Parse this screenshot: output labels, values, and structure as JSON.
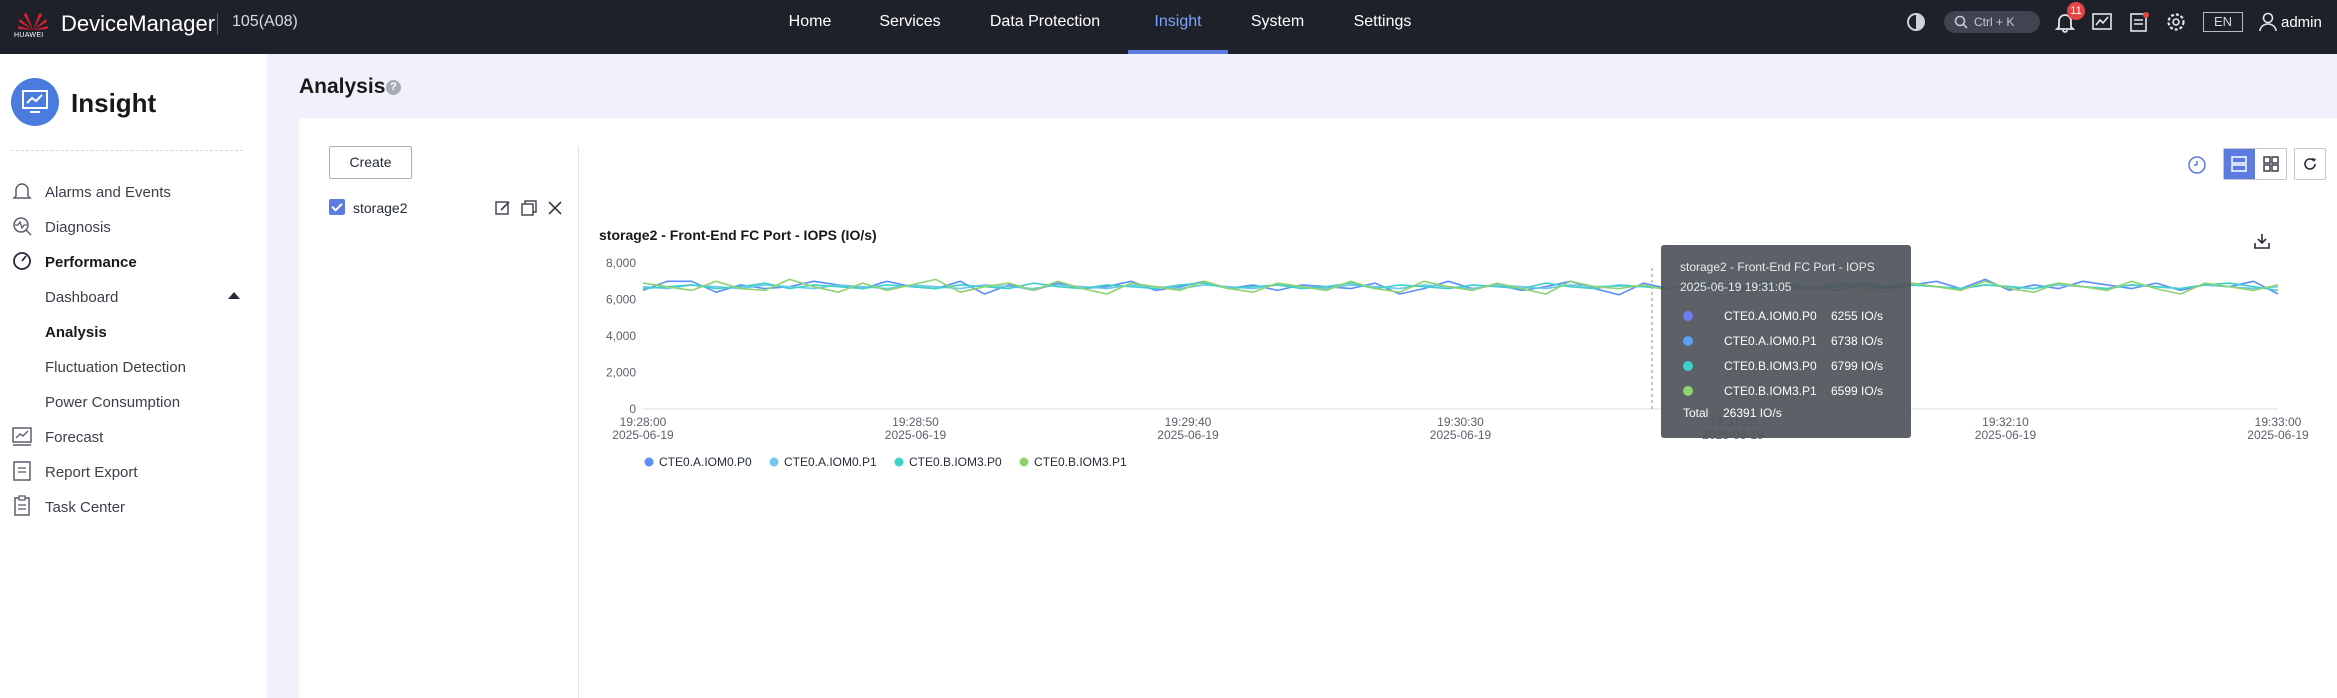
{
  "app": {
    "brand_small": "HUAWEI",
    "brand": "DeviceManager",
    "device_id": "105(A08)"
  },
  "nav": {
    "items": [
      "Home",
      "Services",
      "Data Protection",
      "Insight",
      "System",
      "Settings"
    ],
    "active": "Insight"
  },
  "topbar": {
    "search_hint": "Ctrl + K",
    "notification_count": "11",
    "language": "EN",
    "user": "admin"
  },
  "sidebar": {
    "title": "Insight",
    "items": [
      {
        "label": "Alarms and Events",
        "icon": "bell-icon"
      },
      {
        "label": "Diagnosis",
        "icon": "diagnosis-icon"
      },
      {
        "label": "Performance",
        "icon": "gauge-icon",
        "expanded": true
      },
      {
        "label": "Dashboard",
        "sub": true
      },
      {
        "label": "Analysis",
        "sub": true,
        "active": true
      },
      {
        "label": "Fluctuation Detection",
        "sub": true
      },
      {
        "label": "Power Consumption",
        "sub": true
      },
      {
        "label": "Forecast",
        "icon": "forecast-icon"
      },
      {
        "label": "Report Export",
        "icon": "report-icon"
      },
      {
        "label": "Task Center",
        "icon": "clipboard-icon"
      }
    ]
  },
  "main": {
    "page_title": "Analysis",
    "create_label": "Create",
    "object": {
      "name": "storage2",
      "checked": true
    }
  },
  "colors": {
    "accent": "#5e7ce0",
    "series": [
      "#5b8ff9",
      "#6dc8ec",
      "#3fd1c9",
      "#8fd36f"
    ]
  },
  "chart_data": {
    "type": "line",
    "title": "storage2 - Front-End FC Port - IOPS (IO/s)",
    "ylim": [
      0,
      8000
    ],
    "yticks": [
      "8,000",
      "6,000",
      "4,000",
      "2,000",
      "0"
    ],
    "xticks": [
      {
        "time": "19:28:00",
        "date": "2025-06-19"
      },
      {
        "time": "19:28:50",
        "date": "2025-06-19"
      },
      {
        "time": "19:29:40",
        "date": "2025-06-19"
      },
      {
        "time": "19:30:30",
        "date": "2025-06-19"
      },
      {
        "time": "19:31:20",
        "date": "2025-06-19"
      },
      {
        "time": "19:32:10",
        "date": "2025-06-19"
      },
      {
        "time": "19:33:00",
        "date": "2025-06-19"
      }
    ],
    "series": [
      {
        "name": "CTE0.A.IOM0.P0",
        "values": [
          6500,
          7000,
          7000,
          6400,
          6800,
          6600,
          6700,
          7000,
          6800,
          6600,
          7000,
          6700,
          6600,
          7000,
          6300,
          6800,
          6500,
          6900,
          6600,
          6700,
          7000,
          6500,
          6700,
          7000,
          6600,
          6800,
          6500,
          6800,
          6700,
          6600,
          6900,
          6300,
          6600,
          7000,
          6600,
          6800,
          6500,
          6700,
          7000,
          6600,
          6255,
          6900,
          6600,
          6800,
          6500,
          6700,
          7000,
          6600,
          6700,
          6500,
          6800,
          6700,
          6800,
          7000,
          6600,
          7100,
          6500,
          6800,
          6600,
          7000,
          6800,
          6600,
          6900,
          6500,
          6800,
          6700,
          7000,
          6300
        ]
      },
      {
        "name": "CTE0.A.IOM0.P1",
        "values": [
          6700,
          6600,
          6800,
          6700,
          6600,
          6800,
          6700,
          6600,
          6800,
          6700,
          6600,
          6800,
          6700,
          6600,
          6800,
          6700,
          6600,
          6800,
          6700,
          6600,
          6800,
          6700,
          6600,
          6800,
          6700,
          6600,
          6800,
          6700,
          6600,
          6800,
          6700,
          6600,
          6800,
          6700,
          6600,
          6800,
          6700,
          6600,
          6800,
          6700,
          6738,
          6700,
          6600,
          6800,
          6700,
          6600,
          6800,
          6700,
          6600,
          6800,
          6700,
          6600,
          6800,
          6700,
          6600,
          6800,
          6700,
          6600,
          6800,
          6700,
          6600,
          6800,
          6700,
          6600,
          6800,
          6700,
          6600,
          6700
        ]
      },
      {
        "name": "CTE0.B.IOM3.P0",
        "values": [
          6600,
          6700,
          6800,
          6600,
          6700,
          6900,
          6600,
          6800,
          6700,
          6600,
          6800,
          6700,
          6600,
          6800,
          6700,
          6600,
          6900,
          6700,
          6600,
          6800,
          6700,
          6600,
          6800,
          6900,
          6600,
          6700,
          6800,
          6600,
          6700,
          6900,
          6600,
          6800,
          6700,
          6600,
          6800,
          6700,
          6600,
          6900,
          6700,
          6600,
          6799,
          6700,
          6600,
          6800,
          6900,
          6600,
          6700,
          6800,
          6600,
          6700,
          6900,
          6600,
          6800,
          6700,
          6600,
          6800,
          6700,
          6600,
          6900,
          6700,
          6600,
          6800,
          6700,
          6600,
          6800,
          6900,
          6700,
          6500
        ]
      },
      {
        "name": "CTE0.B.IOM3.P1",
        "values": [
          6900,
          6700,
          6500,
          7000,
          6600,
          6500,
          7100,
          6700,
          6400,
          6900,
          6500,
          6800,
          7100,
          6400,
          6700,
          6900,
          6500,
          7000,
          6600,
          6300,
          6900,
          6700,
          6500,
          7000,
          6600,
          6400,
          6900,
          6700,
          6500,
          7000,
          6600,
          6400,
          7000,
          6700,
          6500,
          6900,
          6600,
          6300,
          7000,
          6700,
          6599,
          6800,
          6500,
          7000,
          6600,
          6400,
          6900,
          6700,
          6500,
          7000,
          6600,
          6400,
          6900,
          6700,
          6500,
          7000,
          6600,
          6400,
          6900,
          6700,
          6500,
          7000,
          6600,
          6300,
          6900,
          6700,
          6500,
          6800
        ]
      }
    ],
    "legend_placement": "bottom-left",
    "tooltip": {
      "title": "storage2 - Front-End FC Port - IOPS",
      "time": "2025-06-19 19:31:05",
      "rows": [
        {
          "name": "CTE0.A.IOM0.P0",
          "value": "6255 IO/s"
        },
        {
          "name": "CTE0.A.IOM0.P1",
          "value": "6738 IO/s"
        },
        {
          "name": "CTE0.B.IOM3.P0",
          "value": "6799 IO/s"
        },
        {
          "name": "CTE0.B.IOM3.P1",
          "value": "6599 IO/s"
        }
      ],
      "total_label": "Total",
      "total_value": "26391 IO/s"
    }
  }
}
